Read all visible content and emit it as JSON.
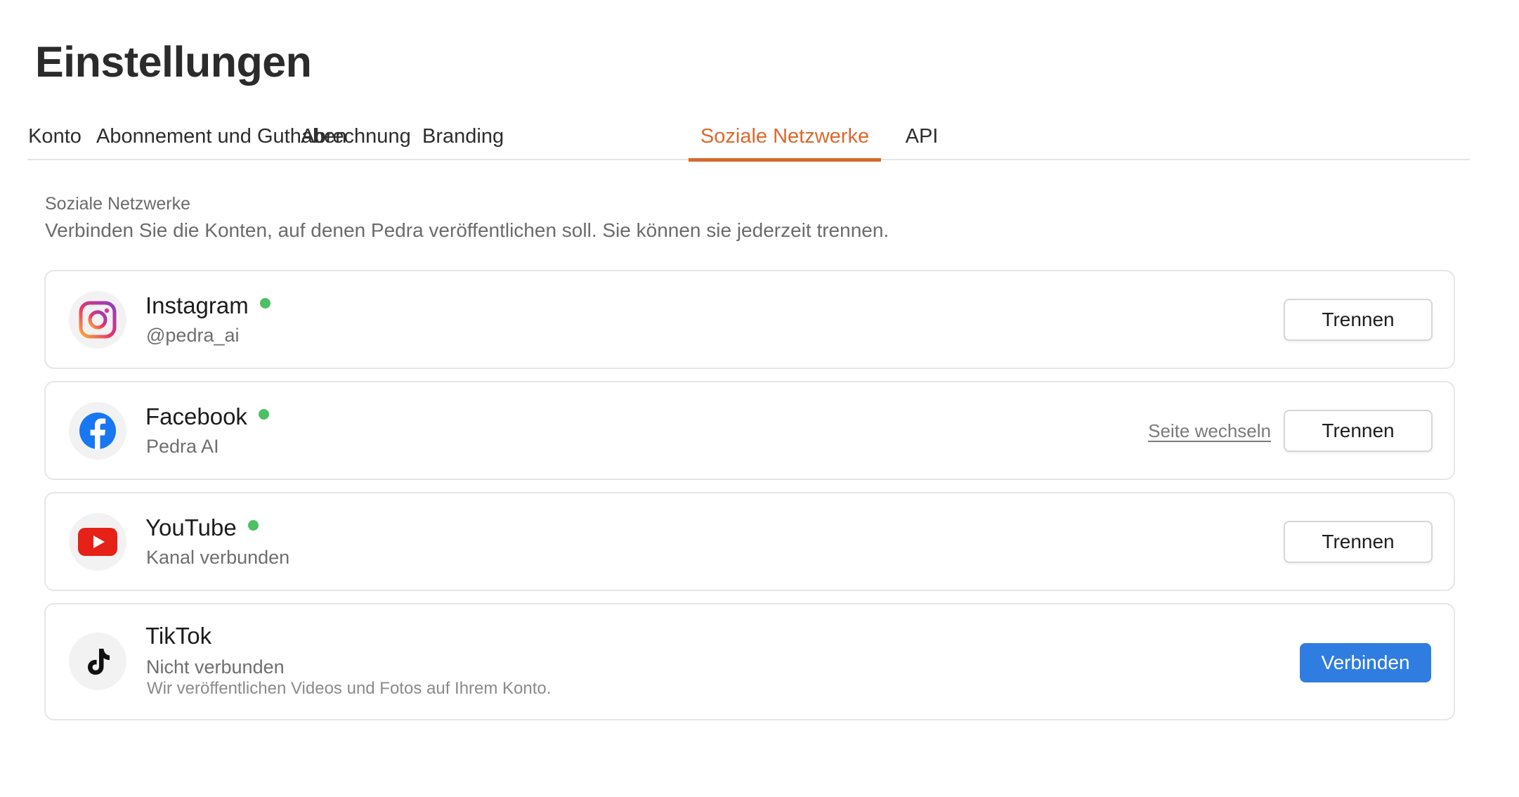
{
  "page": {
    "title": "Einstellungen"
  },
  "tabs": [
    {
      "label": "Konto"
    },
    {
      "label": "Abonnement und Guthaben"
    },
    {
      "label": "Abrechnung"
    },
    {
      "label": "Branding"
    },
    {
      "label": "Soziale Netzwerke",
      "active": true
    },
    {
      "label": "API"
    }
  ],
  "section": {
    "label": "Soziale Netzwerke",
    "description": "Verbinden Sie die Konten, auf denen Pedra veröffentlichen soll. Sie können sie jederzeit trennen."
  },
  "accounts": [
    {
      "name": "Instagram",
      "icon": "instagram-icon",
      "connected": true,
      "subtitle": "@pedra_ai",
      "action_label": "Trennen"
    },
    {
      "name": "Facebook",
      "icon": "facebook-icon",
      "connected": true,
      "subtitle": "Pedra AI",
      "link_label": "Seite wechseln",
      "action_label": "Trennen"
    },
    {
      "name": "YouTube",
      "icon": "youtube-icon",
      "connected": true,
      "subtitle": "Kanal verbunden",
      "action_label": "Trennen"
    },
    {
      "name": "TikTok",
      "icon": "tiktok-icon",
      "connected": false,
      "subtitle": "Nicht verbunden",
      "note": "Wir veröffentlichen Videos und Fotos auf Ihrem Konto.",
      "action_label": "Verbinden"
    }
  ],
  "colors": {
    "accent": "#d9692e",
    "status_connected": "#4cc062",
    "primary_button": "#2f7de1"
  }
}
